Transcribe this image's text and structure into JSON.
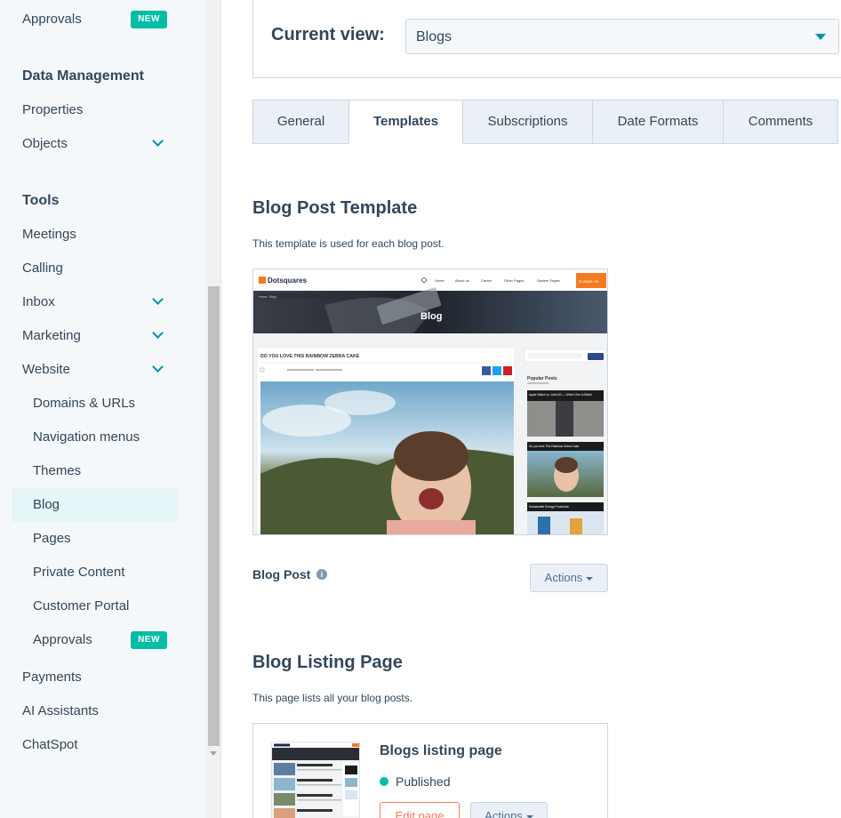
{
  "sidebar": {
    "approvals_top": {
      "label": "Approvals",
      "badge": "NEW"
    },
    "data_management": {
      "heading": "Data Management",
      "items": [
        {
          "label": "Properties"
        },
        {
          "label": "Objects",
          "expandable": true
        }
      ]
    },
    "tools": {
      "heading": "Tools",
      "items": [
        {
          "label": "Meetings"
        },
        {
          "label": "Calling"
        },
        {
          "label": "Inbox",
          "expandable": true
        },
        {
          "label": "Marketing",
          "expandable": true
        },
        {
          "label": "Website",
          "expandable": true
        }
      ]
    },
    "website_sub": [
      {
        "label": "Domains & URLs"
      },
      {
        "label": "Navigation menus"
      },
      {
        "label": "Themes"
      },
      {
        "label": "Blog",
        "active": true
      },
      {
        "label": "Pages"
      },
      {
        "label": "Private Content"
      },
      {
        "label": "Customer Portal"
      },
      {
        "label": "Approvals",
        "badge": "NEW"
      }
    ],
    "bottom_items": [
      {
        "label": "Payments"
      },
      {
        "label": "AI Assistants"
      },
      {
        "label": "ChatSpot"
      }
    ]
  },
  "current_view": {
    "label": "Current view:",
    "value": "Blogs"
  },
  "tabs": [
    {
      "label": "General"
    },
    {
      "label": "Templates",
      "active": true
    },
    {
      "label": "Subscriptions"
    },
    {
      "label": "Date Formats"
    },
    {
      "label": "Comments"
    }
  ],
  "blog_post_template": {
    "title": "Blog Post Template",
    "description": "This template is used for each blog post.",
    "preview": {
      "brand": "Dotsquares",
      "nav": [
        "Home",
        "About us",
        "Career",
        "Other Pages",
        "System Pages"
      ],
      "cta": "Contact Us",
      "breadcrumb": "Home  /  Blog  /",
      "hero_title": "Blog",
      "post_title": "DO YOU LOVE THIS RAINBOW ZEBRA CAKE",
      "popular_heading": "Popular Posts",
      "popular": [
        "Apple Watch vs. Jobs 6S — Which One Is Better",
        "Do you love This Rainbow Zebra Cake",
        "Sustainable Energy Production"
      ]
    },
    "label": "Blog Post",
    "info_icon": "i",
    "actions_label": "Actions"
  },
  "blog_listing_page": {
    "title": "Blog Listing Page",
    "description": "This page lists all your blog posts.",
    "card": {
      "title": "Blogs listing page",
      "status": "Published",
      "edit_label": "Edit page",
      "actions_label": "Actions"
    }
  },
  "colors": {
    "accent": "#0091ae",
    "badge": "#00bda5",
    "text": "#33475b",
    "edit": "#ff7a59",
    "preview_orange": "#f47a20"
  }
}
